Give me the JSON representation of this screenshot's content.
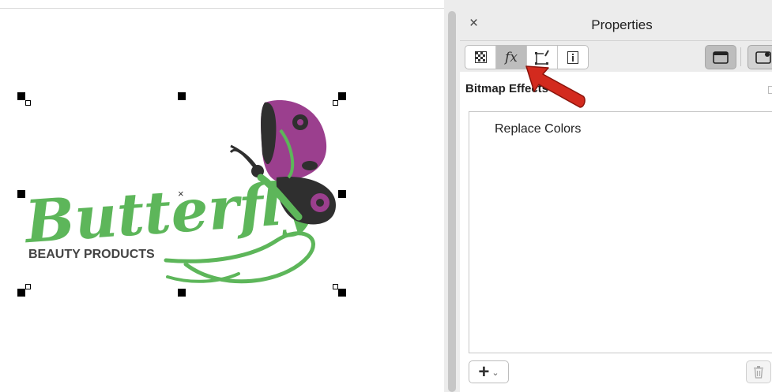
{
  "canvas": {
    "logo": {
      "main_text": "Butterfly",
      "sub_text": "BEAUTY PRODUCTS",
      "text_color": "#5db65a",
      "sub_text_color": "#444444",
      "wing_purple": "#9b3f8e",
      "wing_dark": "#2f2f2f"
    },
    "center_marker": "×"
  },
  "panel": {
    "title": "Properties",
    "close_icon": "×",
    "tabs": [
      {
        "name": "transparency-tab",
        "icon": "checker-icon"
      },
      {
        "name": "effects-tab",
        "label": "fx",
        "active": true
      },
      {
        "name": "frame-tab",
        "icon": "frame-edit-icon"
      },
      {
        "name": "info-tab",
        "icon": "info-icon"
      }
    ],
    "section_title": "Bitmap Effects",
    "effects": [
      "Replace Colors"
    ],
    "add_button": {
      "label": "+",
      "chevron": "⌄"
    },
    "accent_arrow_color": "#d32a1e"
  }
}
